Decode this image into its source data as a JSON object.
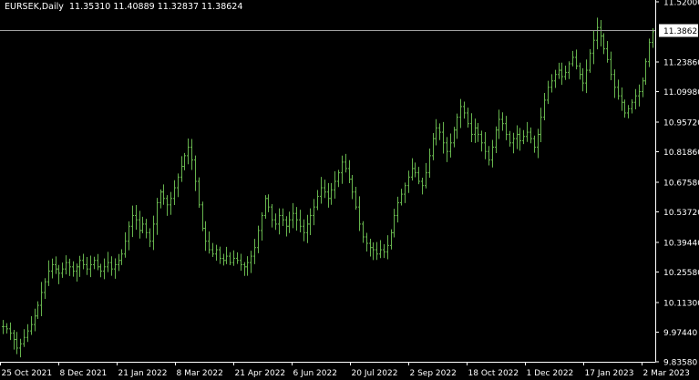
{
  "header": {
    "symbol": "EURSEK,Daily",
    "ohlc": "11.35310 11.40889 11.32837 11.38624"
  },
  "colors": {
    "background": "#000000",
    "bar": "#66b34d",
    "text": "#ffffff",
    "axis": "#ffffff",
    "price_line": "#a0a0a0",
    "price_tag_bg": "#ffffff",
    "price_tag_text": "#000000"
  },
  "chart_data": {
    "type": "bar",
    "style": "ohlc-bars",
    "title": "EURSEK,Daily",
    "current_price": "11.38624",
    "ylim": [
      9.8358,
      11.52
    ],
    "y_ticks": [
      "11.52000",
      "11.38624",
      "11.23860",
      "11.09980",
      "10.95720",
      "10.81860",
      "10.67580",
      "10.53720",
      "10.39440",
      "10.25580",
      "10.11300",
      "9.97440",
      "9.83580"
    ],
    "x_ticks": [
      "25 Oct 2021",
      "8 Dec 2021",
      "21 Jan 2022",
      "8 Mar 2022",
      "21 Apr 2022",
      "6 Jun 2022",
      "20 Jul 2022",
      "2 Sep 2022",
      "18 Oct 2022",
      "1 Dec 2022",
      "17 Jan 2023",
      "2 Mar 2023"
    ],
    "closes": [
      10.0,
      9.99,
      9.97,
      9.94,
      9.9,
      9.92,
      9.95,
      9.98,
      10.01,
      10.05,
      10.1,
      10.16,
      10.21,
      10.26,
      10.29,
      10.27,
      10.25,
      10.27,
      10.3,
      10.28,
      10.26,
      10.28,
      10.31,
      10.29,
      10.27,
      10.29,
      10.31,
      10.28,
      10.26,
      10.28,
      10.3,
      10.27,
      10.29,
      10.31,
      10.34,
      10.4,
      10.47,
      10.52,
      10.5,
      10.45,
      10.48,
      10.44,
      10.4,
      10.48,
      10.58,
      10.63,
      10.6,
      10.57,
      10.6,
      10.65,
      10.7,
      10.75,
      10.8,
      10.84,
      10.78,
      10.68,
      10.57,
      10.46,
      10.4,
      10.36,
      10.34,
      10.36,
      10.32,
      10.31,
      10.33,
      10.3,
      10.32,
      10.31,
      10.29,
      10.28,
      10.3,
      10.33,
      10.37,
      10.45,
      10.52,
      10.6,
      10.56,
      10.5,
      10.48,
      10.52,
      10.5,
      10.47,
      10.5,
      10.53,
      10.5,
      10.47,
      10.44,
      10.48,
      10.52,
      10.56,
      10.61,
      10.65,
      10.63,
      10.6,
      10.64,
      10.68,
      10.72,
      10.77,
      10.74,
      10.69,
      10.63,
      10.56,
      10.48,
      10.42,
      10.39,
      10.37,
      10.36,
      10.34,
      10.36,
      10.35,
      10.38,
      10.44,
      10.52,
      10.58,
      10.62,
      10.66,
      10.7,
      10.74,
      10.72,
      10.68,
      10.66,
      10.72,
      10.8,
      10.88,
      10.93,
      10.91,
      10.86,
      10.82,
      10.86,
      10.92,
      10.98,
      11.03,
      11.0,
      10.95,
      10.9,
      10.93,
      10.9,
      10.86,
      10.82,
      10.78,
      10.84,
      10.92,
      10.97,
      10.95,
      10.9,
      10.86,
      10.88,
      10.9,
      10.87,
      10.89,
      10.91,
      10.88,
      10.84,
      10.9,
      10.98,
      11.06,
      11.12,
      11.15,
      11.18,
      11.2,
      11.17,
      11.19,
      11.23,
      11.26,
      11.22,
      11.18,
      11.14,
      11.2,
      11.28,
      11.34,
      11.4,
      11.36,
      11.3,
      11.25,
      11.18,
      11.12,
      11.08,
      11.05,
      11.0,
      11.02,
      11.05,
      11.08,
      11.1,
      11.15,
      11.24,
      11.33,
      11.38
    ]
  }
}
